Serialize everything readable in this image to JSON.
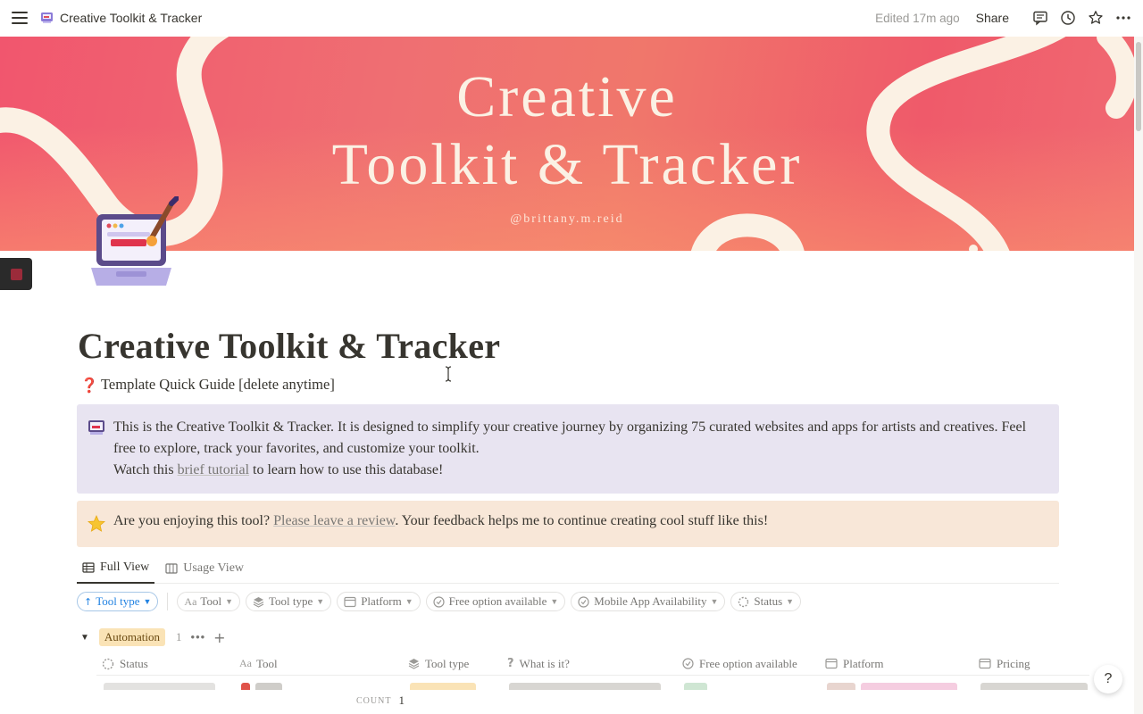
{
  "topbar": {
    "title": "Creative Toolkit & Tracker",
    "edited": "Edited 17m ago",
    "share": "Share"
  },
  "cover": {
    "line1": "Creative",
    "line2": "Toolkit & Tracker",
    "handle": "@brittany.m.reid"
  },
  "page": {
    "title": "Creative Toolkit & Tracker",
    "guide_link": "Template Quick Guide [delete anytime]"
  },
  "callout_info": {
    "line1": "This is the Creative Toolkit & Tracker. It is designed to simplify your creative journey by organizing 75 curated websites and apps for artists and creatives. Feel free to explore, track your favorites, and customize your toolkit.",
    "line2_before": "Watch this ",
    "line2_link": "brief tutorial",
    "line2_after": " to learn how to use this database!"
  },
  "callout_review": {
    "before": "Are you enjoying this tool? ",
    "link": "Please leave a review",
    "after": ". Your feedback helps me to continue creating cool stuff like this!"
  },
  "views": {
    "tabs": [
      "Full View",
      "Usage View"
    ],
    "active": "Full View"
  },
  "filters": {
    "sort": "Tool type",
    "chips": [
      "Tool",
      "Tool type",
      "Platform",
      "Free option available",
      "Mobile App Availability",
      "Status"
    ]
  },
  "group": {
    "name": "Automation",
    "count": "1"
  },
  "table": {
    "columns": [
      "Status",
      "Tool",
      "Tool type",
      "What is it?",
      "Free option available",
      "Platform",
      "Pricing"
    ]
  },
  "footer": {
    "count_label": "COUNT",
    "count_value": "1"
  },
  "help": "?",
  "colors": {
    "accent_blue": "#2383e2",
    "callout_purple": "#e8e4f1",
    "callout_peach": "#f8e7d8",
    "tag_yellow": "#fae3b6",
    "cover_coral": "#f1566e"
  },
  "icons": [
    "menu-icon",
    "page-icon",
    "comment-icon",
    "history-icon",
    "star-icon",
    "more-icon",
    "laptop-emoji-icon",
    "question-mark-icon",
    "computer-emoji-icon",
    "star-emoji-icon",
    "table-icon",
    "board-icon"
  ]
}
